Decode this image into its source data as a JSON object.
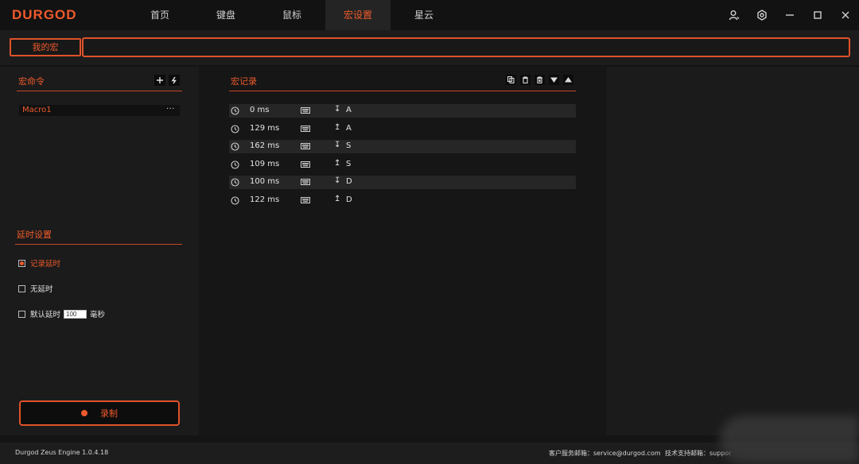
{
  "app": {
    "logo": "DURGOD"
  },
  "nav": {
    "tabs": [
      "首页",
      "键盘",
      "鼠标",
      "宏设置",
      "星云"
    ],
    "active_index": 3
  },
  "window_controls": [
    "user-icon",
    "gear-icon",
    "minimize-icon",
    "maximize-icon",
    "close-icon"
  ],
  "macro_bar": {
    "my_macro_label": "我的宏",
    "macro_name_value": ""
  },
  "left": {
    "commands_title": "宏命令",
    "macros": [
      {
        "name": "Macro1",
        "more": "···"
      }
    ],
    "delay_title": "延时设置",
    "delay_options": [
      {
        "label": "记录延时",
        "checked": true
      },
      {
        "label": "无延时",
        "checked": false
      },
      {
        "label": "默认延时",
        "checked": false,
        "value": "100",
        "unit": "毫秒"
      }
    ],
    "record_label": "录制"
  },
  "middle": {
    "title": "宏记录",
    "tools": [
      "copy-icon",
      "delete-icon",
      "delete-all-icon",
      "move-down-icon",
      "move-up-icon"
    ],
    "records": [
      {
        "delay": "0 ms",
        "action": "↧",
        "key": "A"
      },
      {
        "delay": "129 ms",
        "action": "↥",
        "key": "A"
      },
      {
        "delay": "162 ms",
        "action": "↧",
        "key": "S"
      },
      {
        "delay": "109 ms",
        "action": "↥",
        "key": "S"
      },
      {
        "delay": "100 ms",
        "action": "↧",
        "key": "D"
      },
      {
        "delay": "122 ms",
        "action": "↥",
        "key": "D"
      }
    ]
  },
  "footer": {
    "version": "Durgod Zeus Engine 1.0.4.18",
    "service": "客户服务邮箱：service@durgod.com",
    "support": "技术支持邮箱：suppor"
  },
  "colors": {
    "accent": "#ef5a2c",
    "background": "#141414",
    "panel": "#1b1b1b"
  }
}
